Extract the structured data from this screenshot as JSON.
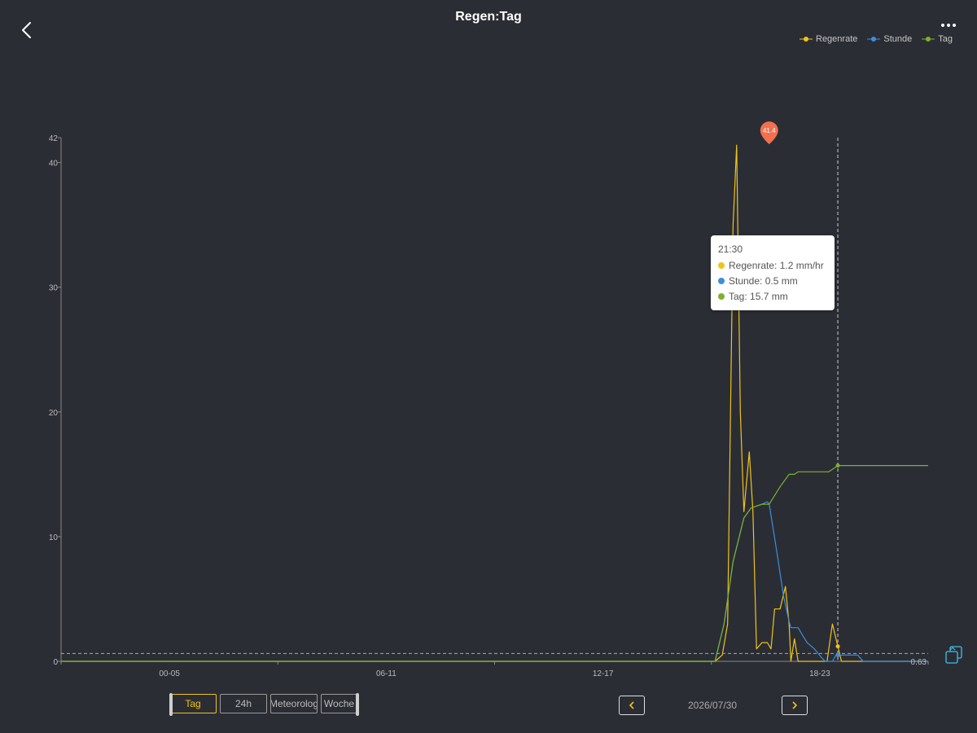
{
  "header": {
    "title": "Regen:Tag"
  },
  "legend": [
    {
      "name": "Regenrate",
      "color": "#f0c419"
    },
    {
      "name": "Stunde",
      "color": "#3b8fdf"
    },
    {
      "name": "Tag",
      "color": "#7cb22a"
    }
  ],
  "tooltip": {
    "time": "21:30",
    "rows": [
      "Regenrate: 1.2 mm/hr",
      "Stunde: 0.5 mm",
      "Tag: 15.7 mm"
    ]
  },
  "tabs": [
    "Tag",
    "24h",
    "Meteorolog",
    "Woche"
  ],
  "active_tab": 0,
  "date": "2026/07/30",
  "chart_data": {
    "type": "line",
    "x_ticks": [
      "00-05",
      "06-11",
      "12-17",
      "18-23"
    ],
    "y_ticks": [
      0,
      10,
      20,
      30,
      40,
      42
    ],
    "ylim": [
      0,
      42
    ],
    "xlim": [
      0,
      24
    ],
    "max_marker": {
      "x": 19.6,
      "y": 41.4,
      "label": "41.4"
    },
    "avg_line": {
      "y": 0.63,
      "label": "0.63"
    },
    "crosshair_x": 21.5,
    "series": [
      {
        "name": "Regenrate",
        "color": "#f0c419",
        "points": [
          [
            0,
            0
          ],
          [
            18.1,
            0
          ],
          [
            18.3,
            0.5
          ],
          [
            18.45,
            3
          ],
          [
            18.6,
            35
          ],
          [
            18.7,
            41.4
          ],
          [
            18.8,
            20
          ],
          [
            18.9,
            12
          ],
          [
            19.05,
            16.8
          ],
          [
            19.15,
            12
          ],
          [
            19.25,
            1
          ],
          [
            19.4,
            1.5
          ],
          [
            19.55,
            1.5
          ],
          [
            19.65,
            1
          ],
          [
            19.75,
            4.2
          ],
          [
            19.9,
            4.2
          ],
          [
            20.05,
            6
          ],
          [
            20.15,
            3
          ],
          [
            20.2,
            0
          ],
          [
            20.3,
            1.8
          ],
          [
            20.4,
            0
          ],
          [
            21.2,
            0
          ],
          [
            21.35,
            3
          ],
          [
            21.5,
            1.2
          ],
          [
            21.6,
            0
          ],
          [
            24,
            0
          ]
        ]
      },
      {
        "name": "Stunde",
        "color": "#3b8fdf",
        "points": [
          [
            0,
            0
          ],
          [
            18.1,
            0
          ],
          [
            18.35,
            3
          ],
          [
            18.6,
            8
          ],
          [
            18.9,
            11.5
          ],
          [
            19.1,
            12.3
          ],
          [
            19.4,
            12.6
          ],
          [
            19.55,
            12.8
          ],
          [
            19.6,
            12.6
          ],
          [
            19.8,
            9
          ],
          [
            20,
            5.2
          ],
          [
            20.15,
            3.2
          ],
          [
            20.2,
            2.7
          ],
          [
            20.4,
            2.7
          ],
          [
            20.5,
            2.2
          ],
          [
            20.65,
            1.5
          ],
          [
            20.85,
            1
          ],
          [
            21.05,
            0.3
          ],
          [
            21.15,
            0
          ],
          [
            21.35,
            0
          ],
          [
            21.45,
            0.5
          ],
          [
            21.75,
            0.5
          ],
          [
            22.05,
            0.5
          ],
          [
            22.2,
            0
          ],
          [
            24,
            0
          ]
        ]
      },
      {
        "name": "Tag",
        "color": "#7cb22a",
        "points": [
          [
            0,
            0
          ],
          [
            18.1,
            0
          ],
          [
            18.35,
            3
          ],
          [
            18.6,
            8
          ],
          [
            18.9,
            11.5
          ],
          [
            19.1,
            12.3
          ],
          [
            19.4,
            12.6
          ],
          [
            19.6,
            12.6
          ],
          [
            19.9,
            14
          ],
          [
            20.15,
            15
          ],
          [
            20.3,
            15
          ],
          [
            20.4,
            15.2
          ],
          [
            21.25,
            15.2
          ],
          [
            21.5,
            15.7
          ],
          [
            21.55,
            15.7
          ],
          [
            24,
            15.7
          ]
        ]
      }
    ]
  }
}
